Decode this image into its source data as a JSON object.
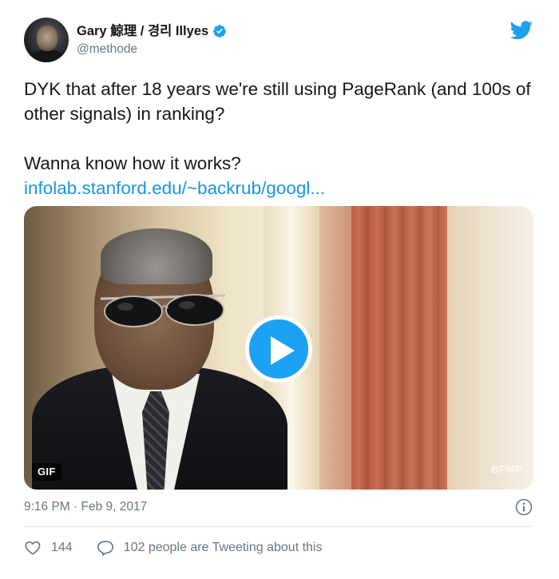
{
  "user": {
    "display_name": "Gary 鯨理 / 경리 Illyes",
    "handle": "@methode",
    "verified": true,
    "avatar_icon": "avatar"
  },
  "tweet": {
    "line1": "DYK that after 18 years we're still using PageRank (and 100s of other signals) in ranking?",
    "line2": "Wanna know how it works?",
    "link": "infolab.stanford.edu/~backrub/googl..."
  },
  "media": {
    "badge": "GIF",
    "watermark": "BFMP",
    "play_icon": "play-icon"
  },
  "meta": {
    "timestamp": "9:16 PM · Feb 9, 2017"
  },
  "actions": {
    "likes": "144",
    "conversation": "102 people are Tweeting about this"
  },
  "colors": {
    "brand": "#1da1f2",
    "link": "#1b95e0",
    "muted": "#657786"
  }
}
